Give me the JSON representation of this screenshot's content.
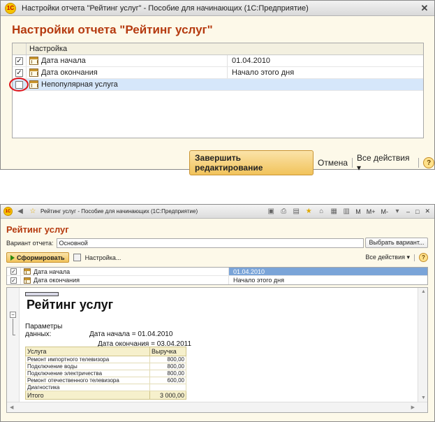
{
  "dialog": {
    "window_title": "Настройки отчета \"Рейтинг услуг\" - Пособие для начинающих  (1С:Предприятие)",
    "logo": "1С",
    "heading": "Настройки отчета \"Рейтинг услуг\"",
    "column_header": "Настройка",
    "rows": [
      {
        "checked": true,
        "name": "Дата начала",
        "value": "01.04.2010"
      },
      {
        "checked": true,
        "name": "Дата окончания",
        "value": "Начало этого дня"
      },
      {
        "checked": false,
        "name": "Непопулярная услуга",
        "value": ""
      }
    ],
    "footer": {
      "finish_label": "Завершить редактирование",
      "cancel_label": "Отмена",
      "all_actions_label": "Все действия ▾",
      "help_label": "?"
    },
    "close_glyph": "✕"
  },
  "window": {
    "title": "Рейтинг услуг - Пособие для начинающих  (1С:Предприятие)",
    "tb_m": "M",
    "tb_mplus": "M+",
    "tb_mminus": "M-",
    "tb_min": "–",
    "tb_max": "□",
    "tb_close": "✕",
    "heading": "Рейтинг услуг",
    "variant_label": "Вариант отчета:",
    "variant_value": "Основной",
    "choose_variant": "Выбрать вариант...",
    "generate_label": "Сформировать",
    "settings_label": "Настройка...",
    "all_actions_label": "Все действия ▾",
    "help_label": "?",
    "rows": [
      {
        "checked": true,
        "name": "Дата начала",
        "value": "01.04.2010"
      },
      {
        "checked": true,
        "name": "Дата окончания",
        "value": "Начало этого дня"
      }
    ],
    "report": {
      "title": "Рейтинг услуг",
      "params_label": "Параметры данных:",
      "param1": "Дата начала = 01.04.2010",
      "param2": "Дата окончания = 03.04.2011",
      "col_service": "Услуга",
      "col_revenue": "Выручка",
      "items": [
        {
          "name": "Ремонт импортного телевизора",
          "value": "800,00"
        },
        {
          "name": "Подключение воды",
          "value": "800,00"
        },
        {
          "name": "Подключение электричества",
          "value": "800,00"
        },
        {
          "name": "Ремонт отечественного телевизора",
          "value": "600,00"
        },
        {
          "name": "Диагностика",
          "value": ""
        }
      ],
      "total_label": "Итого",
      "total_value": "3 000,00"
    }
  },
  "colors": {
    "accent_title": "#b53a0f",
    "selection": "#d6e7fa",
    "primary_button": "#f1c35b"
  }
}
